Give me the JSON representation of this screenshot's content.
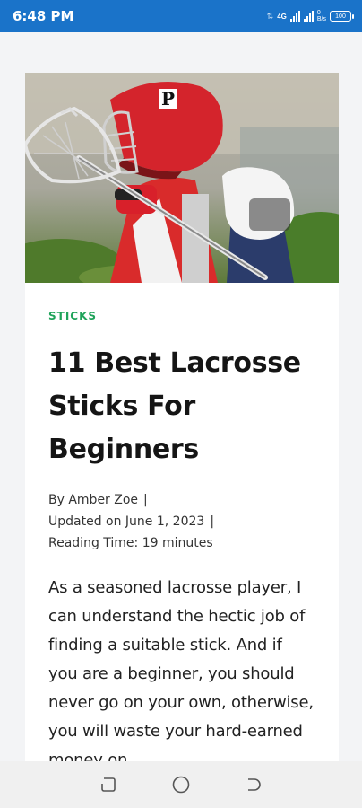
{
  "status": {
    "time": "6:48 PM",
    "network": "4G",
    "battery": "100"
  },
  "article": {
    "category": "STICKS",
    "title": "11 Best Lacrosse Sticks For Beginners",
    "author": "By Amber Zoe",
    "updated": "Updated on June 1, 2023",
    "reading_time": "Reading Time: 19 minutes",
    "separator": "|",
    "body": "As a seasoned lacrosse player, I can understand the hectic job of finding a suitable stick. And if you are a beginner, you should never go on your own, otherwise, you will waste your hard-earned money on"
  },
  "hero_image": {
    "helmet_letter": "P"
  },
  "nav": {
    "recents": "recents-icon",
    "home": "home-icon",
    "back": "back-icon"
  }
}
